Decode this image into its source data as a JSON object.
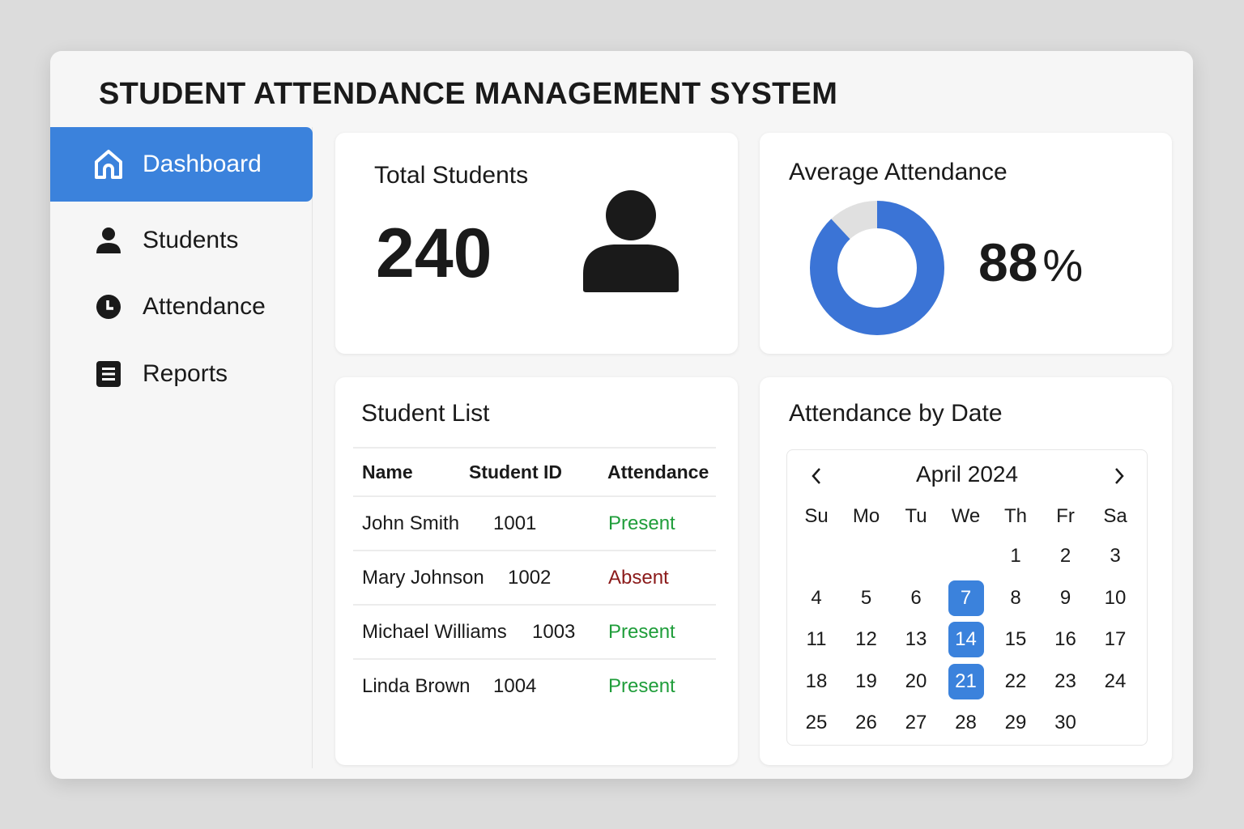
{
  "app_title": "STUDENT ATTENDANCE MANAGEMENT SYSTEM",
  "sidebar": {
    "items": [
      {
        "label": "Dashboard",
        "icon": "home-icon",
        "active": true
      },
      {
        "label": "Students",
        "icon": "person-icon"
      },
      {
        "label": "Attendance",
        "icon": "clock-icon"
      },
      {
        "label": "Reports",
        "icon": "document-icon"
      }
    ]
  },
  "total_students": {
    "title": "Total Students",
    "value": "240",
    "icon": "person-icon"
  },
  "average_attendance": {
    "title": "Average Attendance",
    "value": "88",
    "unit": "%",
    "percent": 88
  },
  "student_list": {
    "title": "Student List",
    "headers": [
      "Name",
      "Student ID",
      "Attendance"
    ],
    "rows": [
      {
        "name": "John Smith",
        "id": "1001",
        "status": "Present"
      },
      {
        "name": "Mary Johnson",
        "id": "1002",
        "status": "Absent"
      },
      {
        "name": "Michael Williams",
        "id": "1003",
        "status": "Present"
      },
      {
        "name": "Linda Brown",
        "id": "1004",
        "status": "Present"
      }
    ]
  },
  "calendar": {
    "title": "Attendance by Date",
    "month": "April 2024",
    "weekdays": [
      "Su",
      "Mo",
      "Tu",
      "We",
      "Th",
      "Fr",
      "Sa"
    ],
    "first_weekday": 4,
    "days": 30,
    "selected": [
      7,
      14,
      21
    ]
  },
  "colors": {
    "accent": "#3b82dc",
    "present": "#1f9d3a",
    "absent": "#8b1a1a",
    "ring_bg": "#e0e0e0"
  }
}
